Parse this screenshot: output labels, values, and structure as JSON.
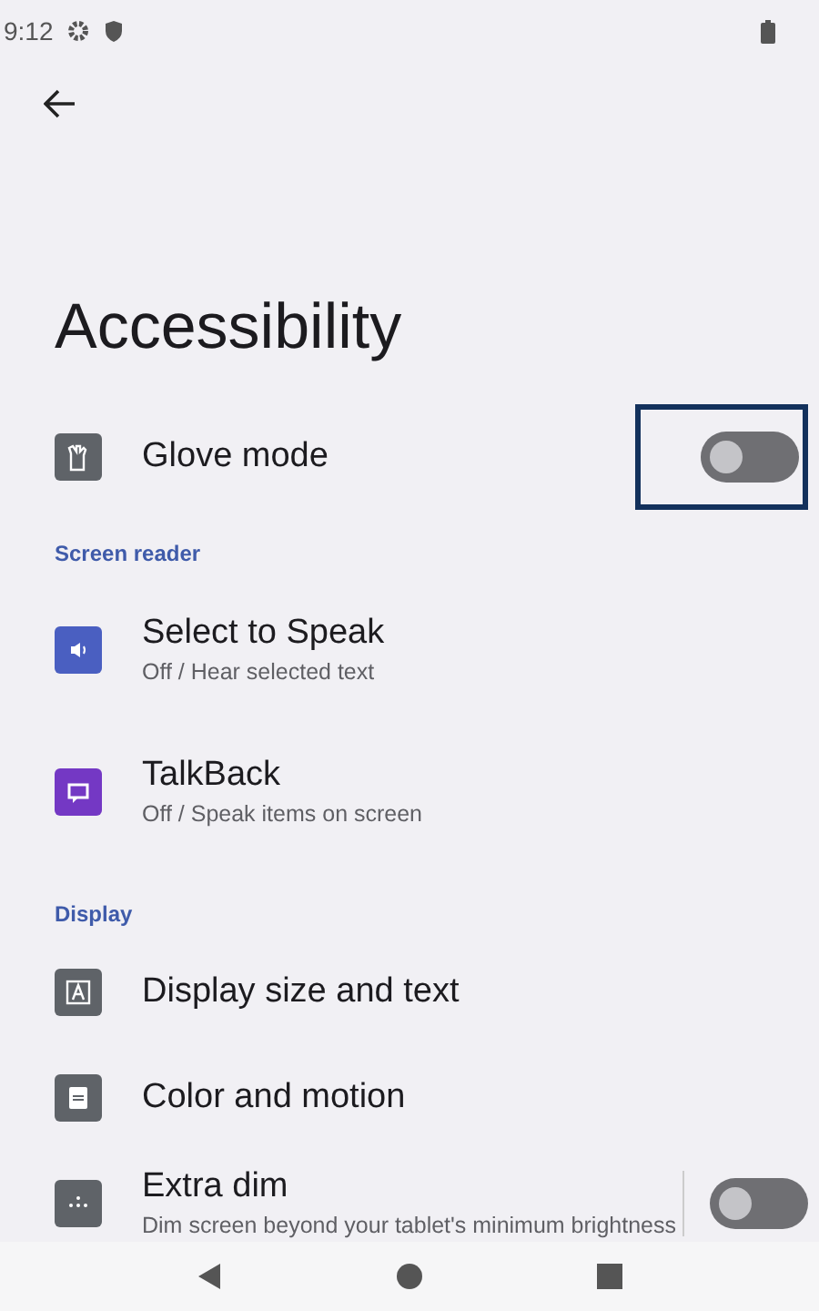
{
  "status_bar": {
    "time": "9:12"
  },
  "title": "Accessibility",
  "top_item": {
    "label": "Glove mode",
    "color": "#5f6368",
    "on": false,
    "highlighted": true
  },
  "sections": [
    {
      "header": "Screen reader",
      "items": [
        {
          "kind": "link",
          "label": "Select to Speak",
          "summary": "Off / Hear selected text",
          "color": "#4a5fc1"
        },
        {
          "kind": "link",
          "label": "TalkBack",
          "summary": "Off / Speak items on screen",
          "color": "#7438c4"
        }
      ]
    },
    {
      "header": "Display",
      "items": [
        {
          "kind": "link",
          "label": "Display size and text",
          "color": "#5f6368"
        },
        {
          "kind": "link",
          "label": "Color and motion",
          "color": "#5f6368"
        },
        {
          "kind": "toggle",
          "label": "Extra dim",
          "summary": "Dim screen beyond your tablet's minimum brightness",
          "color": "#5f6368",
          "on": false
        }
      ]
    }
  ]
}
